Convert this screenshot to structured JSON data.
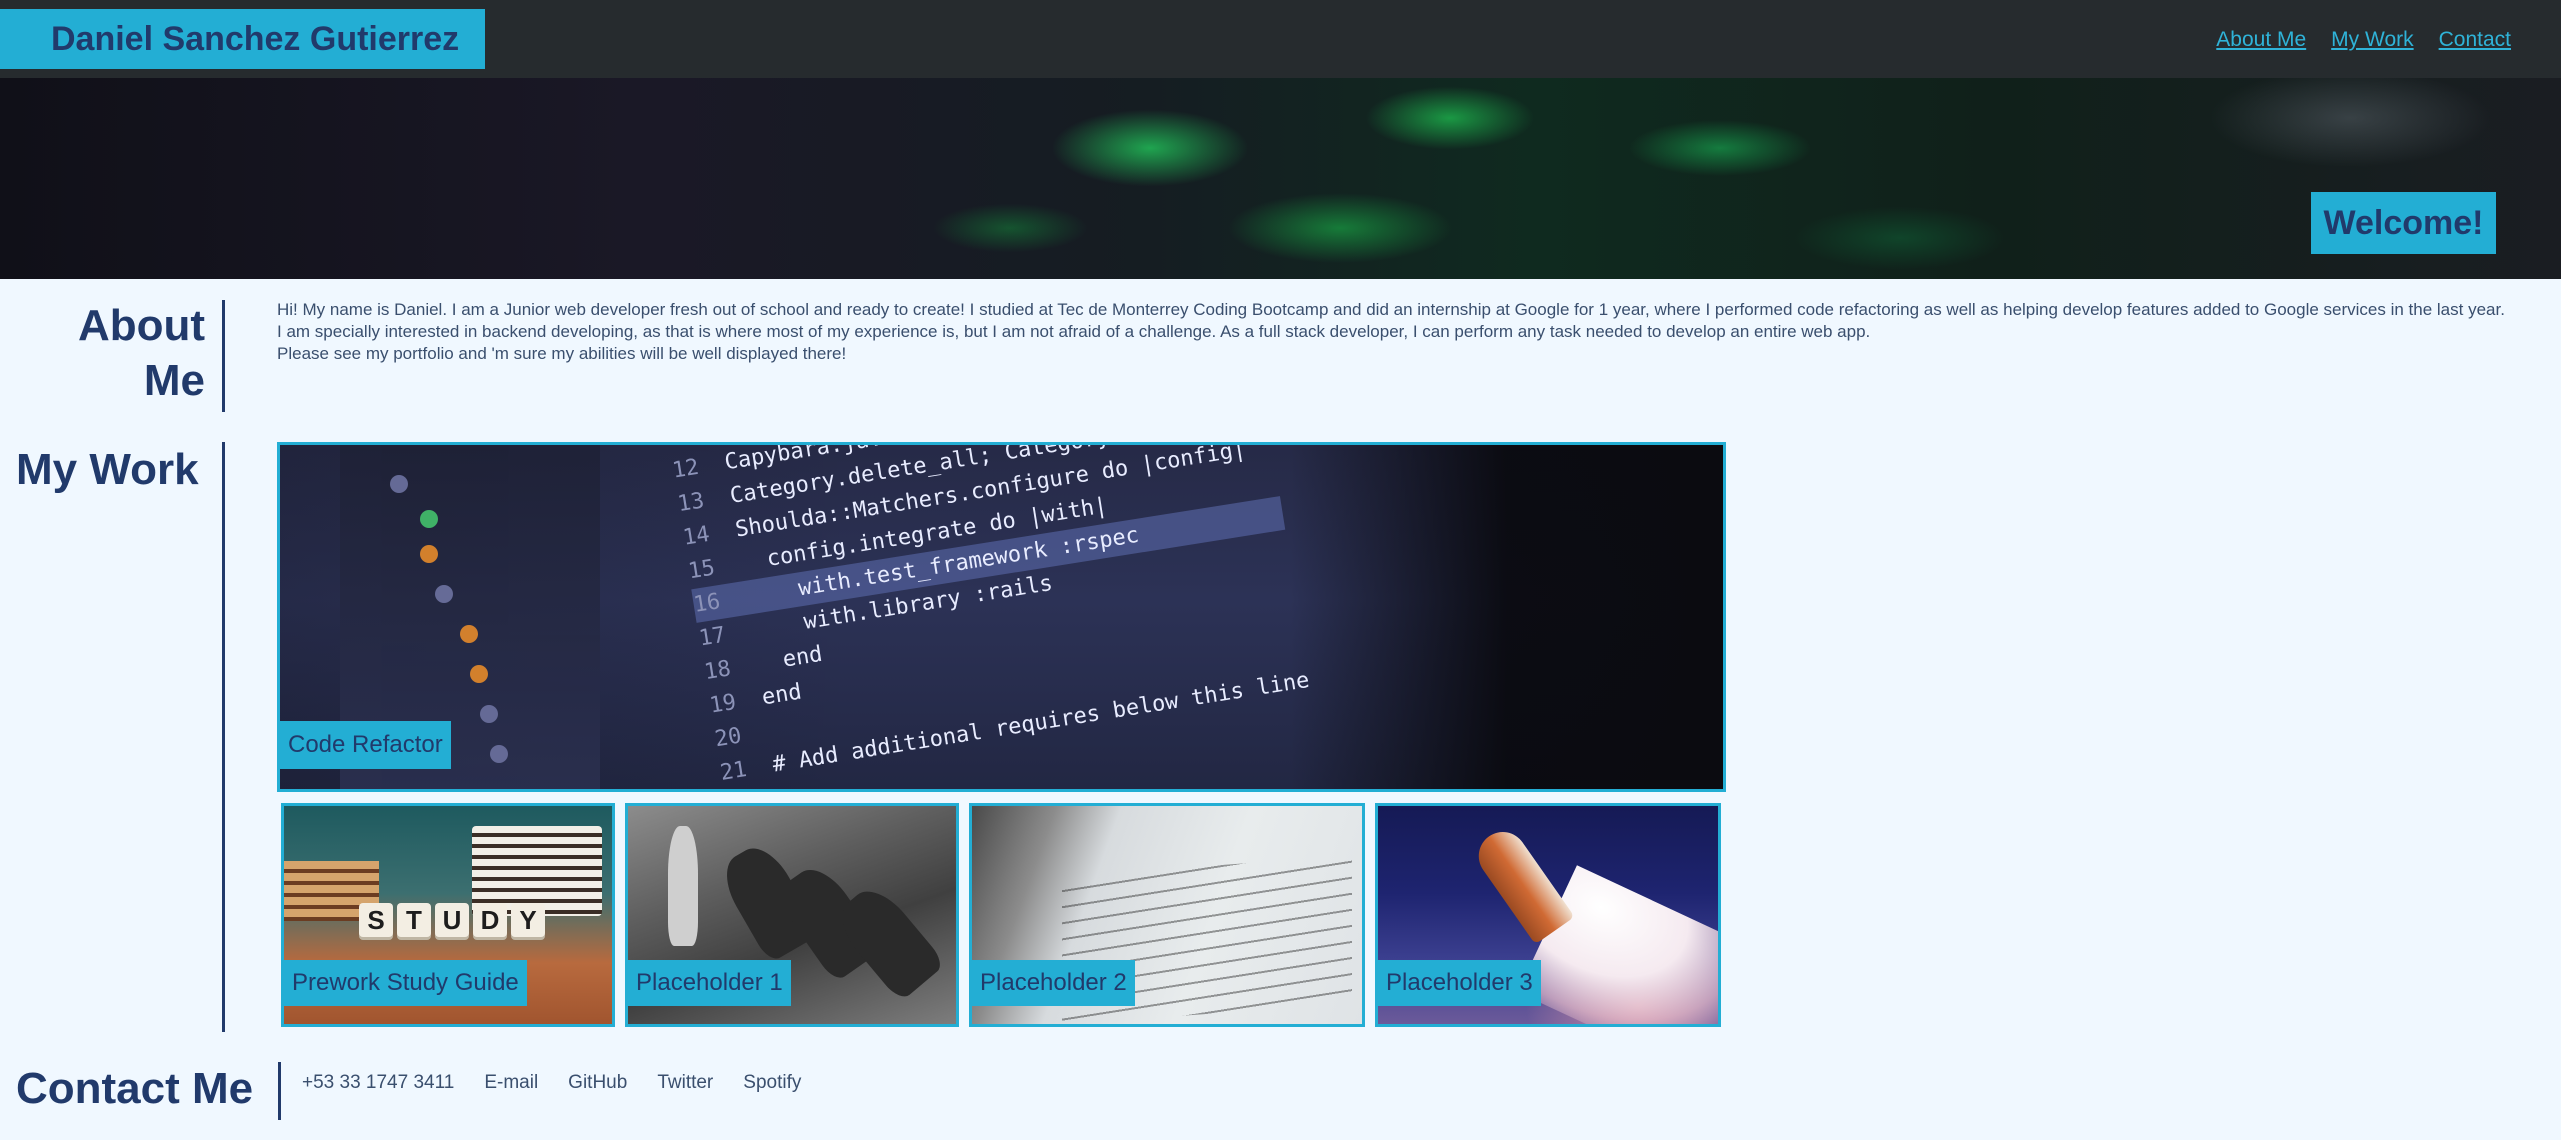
{
  "header": {
    "name": "Daniel Sanchez Gutierrez",
    "nav": [
      "About Me",
      "My Work",
      "Contact"
    ]
  },
  "hero": {
    "welcome": "Welcome!"
  },
  "about": {
    "title_line1": "About",
    "title_line2": "Me",
    "paragraph1": "Hi! My name is Daniel. I am a Junior web developer fresh out of school and ready to create! I studied at Tec de Monterrey Coding Bootcamp and did an internship at Google for 1 year, where I performed code refactoring as well as helping develop features added to Google services in the last year.",
    "paragraph2": "I am specially interested in backend developing, as that is where most of my experience is, but I am not afraid of a challenge. As a full stack developer, I can perform any task needed to develop an entire web app.",
    "paragraph3": "Please see my portfolio and 'm sure my abilities will be well displayed there!"
  },
  "work": {
    "title": "My Work",
    "featured": {
      "caption": "Code Refactor",
      "code_lines": [
        {
          "n": "12",
          "text": "Capybara.javascript_driver"
        },
        {
          "n": "13",
          "text": "Category.delete_all; Category.generate"
        },
        {
          "n": "14",
          "text": "Shoulda::Matchers.configure do |config|"
        },
        {
          "n": "15",
          "text": "  config.integrate do |with|"
        },
        {
          "n": "16",
          "text": "    with.test_framework :rspec"
        },
        {
          "n": "17",
          "text": "    with.library :rails"
        },
        {
          "n": "18",
          "text": "  end"
        },
        {
          "n": "19",
          "text": "end"
        },
        {
          "n": "20",
          "text": ""
        },
        {
          "n": "21",
          "text": "# Add additional requires below this line"
        }
      ]
    },
    "projects": [
      {
        "caption": "Prework Study Guide",
        "cube_letters": [
          "S",
          "T",
          "U",
          "D",
          "Y"
        ]
      },
      {
        "caption": "Placeholder 1"
      },
      {
        "caption": "Placeholder 2"
      },
      {
        "caption": "Placeholder 3"
      }
    ]
  },
  "contact": {
    "title": "Contact Me",
    "links": [
      "+53 33 1747 3411",
      "E-mail",
      "GitHub",
      "Twitter",
      "Spotify"
    ]
  },
  "colors": {
    "accent": "#23aed4",
    "header_bg": "#262b2e",
    "text_dark": "#213a6b",
    "page_bg": "#f0f8ff"
  }
}
